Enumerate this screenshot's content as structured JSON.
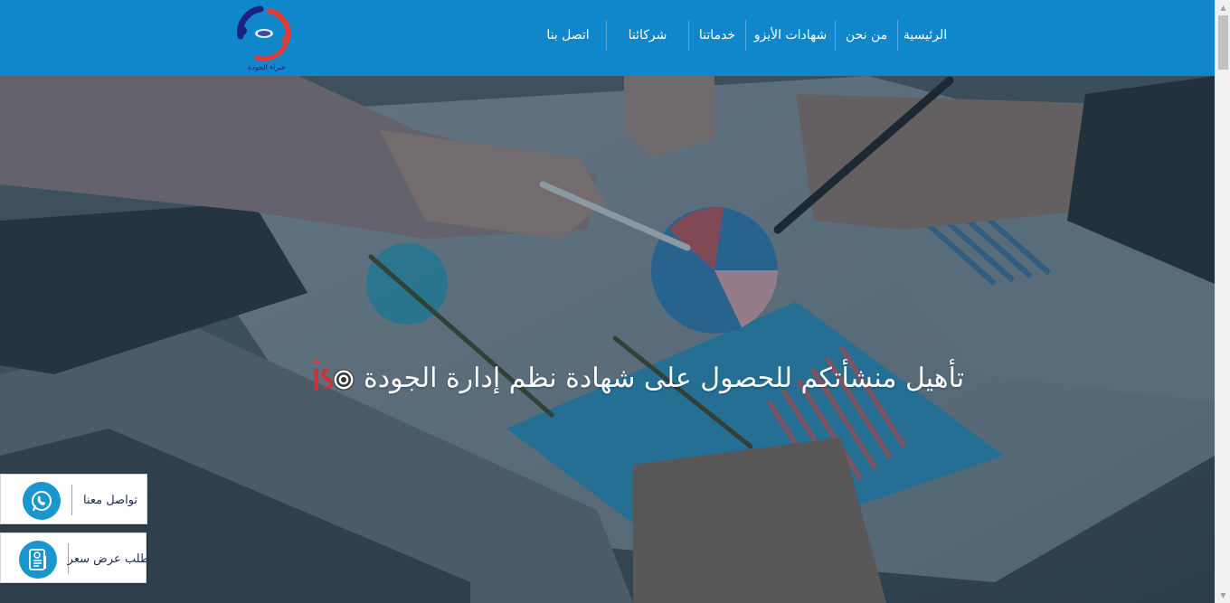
{
  "header": {
    "logo_caption": "خبراء الجودة",
    "nav": [
      {
        "label": "الرئيسية",
        "name": "nav-home"
      },
      {
        "label": "من نحن",
        "name": "nav-about"
      },
      {
        "label": "شهادات الأيزو",
        "name": "nav-iso-certificates"
      },
      {
        "label": "خدماتنا",
        "name": "nav-services"
      },
      {
        "label": "شركائنا",
        "name": "nav-partners"
      },
      {
        "label": "اتصل بنا",
        "name": "nav-contact"
      }
    ]
  },
  "hero": {
    "title": "تأهيل منشأتكم للحصول على شهادة نظم إدارة الجودة",
    "badge_text": "is"
  },
  "floating": {
    "whatsapp_label": "تواصل معنا",
    "quote_label": "طلب عرض سعر"
  },
  "colors": {
    "header_bg": "#1187cb",
    "accent_blue": "#1a96cf",
    "hero_overlay": "#2d4352"
  },
  "icons": {
    "whatsapp": "whatsapp-icon",
    "quote": "document-icon",
    "badge": "iso-target-icon"
  }
}
